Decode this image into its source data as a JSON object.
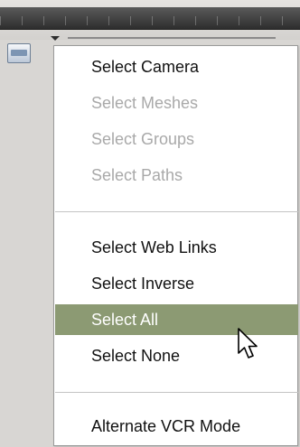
{
  "menu": {
    "items": [
      {
        "label": "Select Camera",
        "enabled": true,
        "highlighted": false
      },
      {
        "label": "Select Meshes",
        "enabled": false,
        "highlighted": false
      },
      {
        "label": "Select Groups",
        "enabled": false,
        "highlighted": false
      },
      {
        "label": "Select Paths",
        "enabled": false,
        "highlighted": false
      },
      {
        "label": "Select Web Links",
        "enabled": true,
        "highlighted": false
      },
      {
        "label": "Select Inverse",
        "enabled": true,
        "highlighted": false
      },
      {
        "label": "Select All",
        "enabled": true,
        "highlighted": true
      },
      {
        "label": "Select None",
        "enabled": true,
        "highlighted": false
      },
      {
        "label": "Alternate VCR Mode",
        "enabled": true,
        "highlighted": false
      }
    ]
  },
  "toolbar": {
    "icon": "selection-tool-icon"
  },
  "colors": {
    "highlight": "#8c9a73",
    "disabled_text": "#a9a9a9",
    "text": "#111111"
  }
}
